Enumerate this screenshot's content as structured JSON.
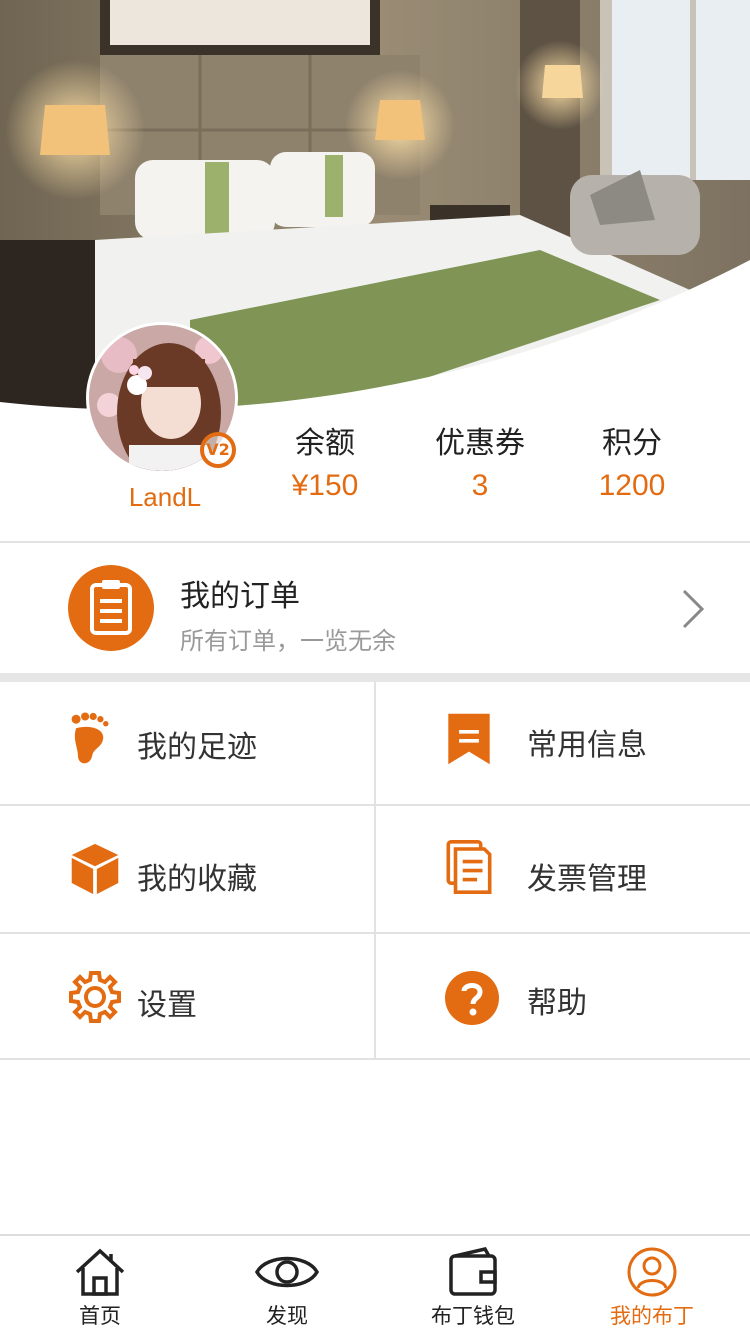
{
  "user": {
    "name": "LandL",
    "level": "V2"
  },
  "stats": [
    {
      "label": "余额",
      "value": "¥150"
    },
    {
      "label": "优惠券",
      "value": "3"
    },
    {
      "label": "积分",
      "value": "1200"
    }
  ],
  "orders": {
    "title": "我的订单",
    "subtitle": "所有订单，一览无余"
  },
  "menu": [
    {
      "label": "我的足迹",
      "icon": "footprint-icon"
    },
    {
      "label": "常用信息",
      "icon": "bookmark-icon"
    },
    {
      "label": "我的收藏",
      "icon": "box-icon"
    },
    {
      "label": "发票管理",
      "icon": "invoice-icon"
    },
    {
      "label": "设置",
      "icon": "gear-icon"
    },
    {
      "label": "帮助",
      "icon": "help-icon"
    }
  ],
  "tabs": [
    {
      "label": "首页",
      "icon": "home-icon"
    },
    {
      "label": "发现",
      "icon": "eye-icon"
    },
    {
      "label": "布丁钱包",
      "icon": "wallet-icon"
    },
    {
      "label": "我的布丁",
      "icon": "user-icon"
    }
  ],
  "colors": {
    "accent": "#e36c12",
    "divider": "#e2e2e2"
  }
}
